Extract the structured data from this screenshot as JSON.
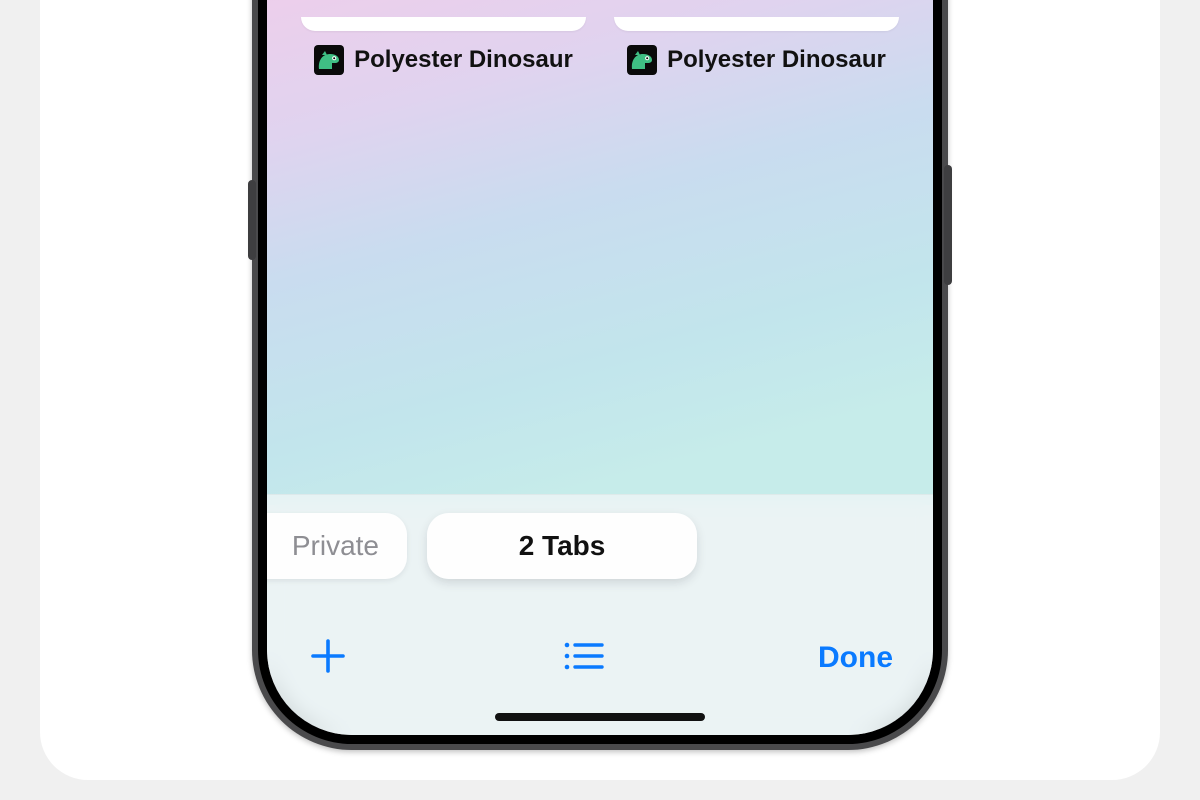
{
  "tabs": [
    {
      "title": "Polyester Dinosaur",
      "favicon": "dinosaur-icon"
    },
    {
      "title": "Polyester Dinosaur",
      "favicon": "dinosaur-icon"
    }
  ],
  "tab_groups": {
    "private_label": "Private",
    "active_label": "2 Tabs"
  },
  "toolbar": {
    "done_label": "Done"
  },
  "colors": {
    "ios_blue": "#0a7aff",
    "muted_text": "#8e8e93"
  }
}
